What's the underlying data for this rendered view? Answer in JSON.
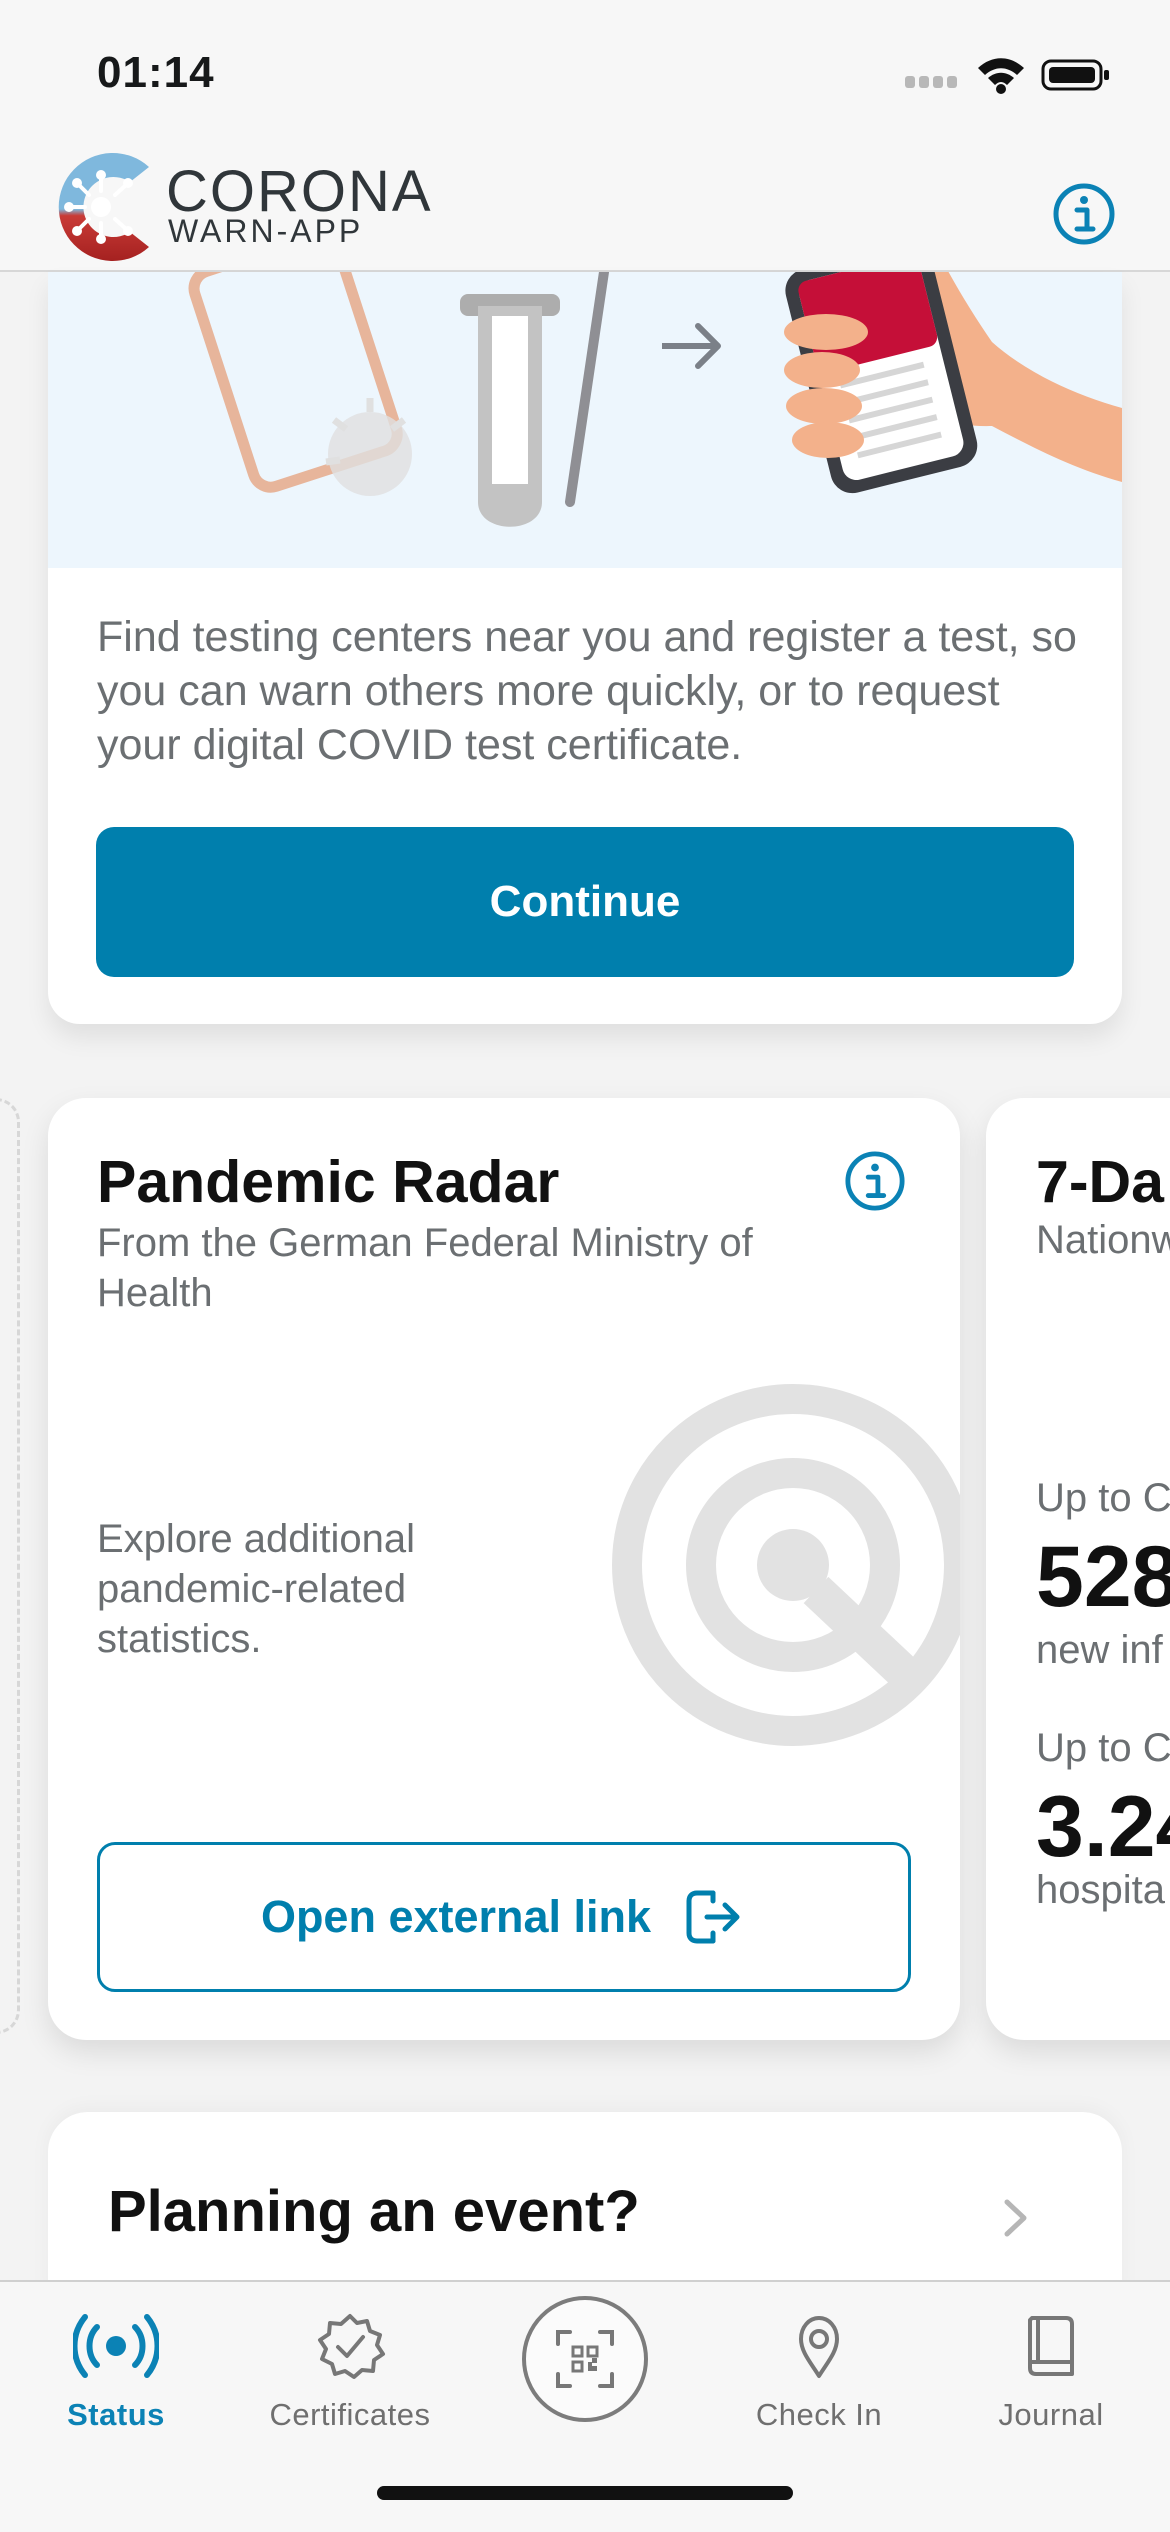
{
  "status_bar": {
    "time": "01:14"
  },
  "header": {
    "brand_main": "CORONA",
    "brand_sub": "WARN-APP",
    "info_icon": "info-icon"
  },
  "test_card": {
    "description": "Find testing centers near you and register a test, so you can warn others more quickly, or to request your digital COVID test certificate.",
    "continue_label": "Continue"
  },
  "pandemic_radar": {
    "title": "Pandemic Radar",
    "subtitle": "From the German Federal Ministry of Health",
    "description": "Explore additional pandemic-related statistics.",
    "button_label": "Open external link",
    "info_icon": "info-icon",
    "external_icon": "external-link-icon",
    "graphic_icon": "radar-search-icon"
  },
  "next_card": {
    "title": "7-Da",
    "subtitle": "Nationw",
    "label_1": "Up to C",
    "value_1": "528",
    "caption_1": "new inf",
    "label_2": "Up to C",
    "value_2": "3.24",
    "caption_2": "hospita"
  },
  "event_card": {
    "title": "Planning an event?",
    "chevron_icon": "chevron-right-icon"
  },
  "tab_bar": {
    "tabs": [
      {
        "label": "Status",
        "icon": "status-icon",
        "active": true
      },
      {
        "label": "Certificates",
        "icon": "certificate-icon",
        "active": false
      },
      {
        "label": "Check In",
        "icon": "location-pin-icon",
        "active": false
      },
      {
        "label": "Journal",
        "icon": "journal-icon",
        "active": false
      }
    ],
    "scan_icon": "qr-scan-icon"
  },
  "colors": {
    "accent": "#007fad",
    "logo_blue": "#6aa8d1",
    "logo_red": "#b72f2e",
    "background": "#f3f3f3",
    "card": "#ffffff",
    "text_secondary": "#6b6f72"
  }
}
